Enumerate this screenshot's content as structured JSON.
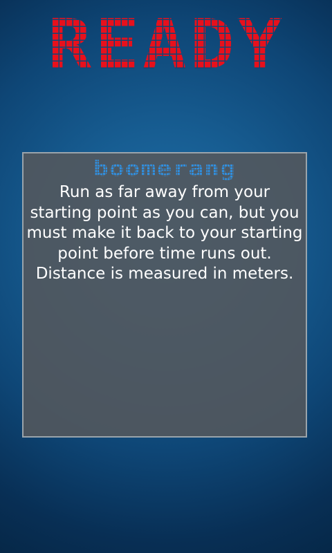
{
  "screen": {
    "headline": "READY",
    "headline_color": "#e8101c",
    "background_color": "#0e4676"
  },
  "panel": {
    "mode_title": "boomerang",
    "mode_title_color": "#2f8fe0",
    "description": "Run as far away from your starting point as you can, but you must make it back to your starting point before time runs out.  Distance is measured in meters."
  }
}
